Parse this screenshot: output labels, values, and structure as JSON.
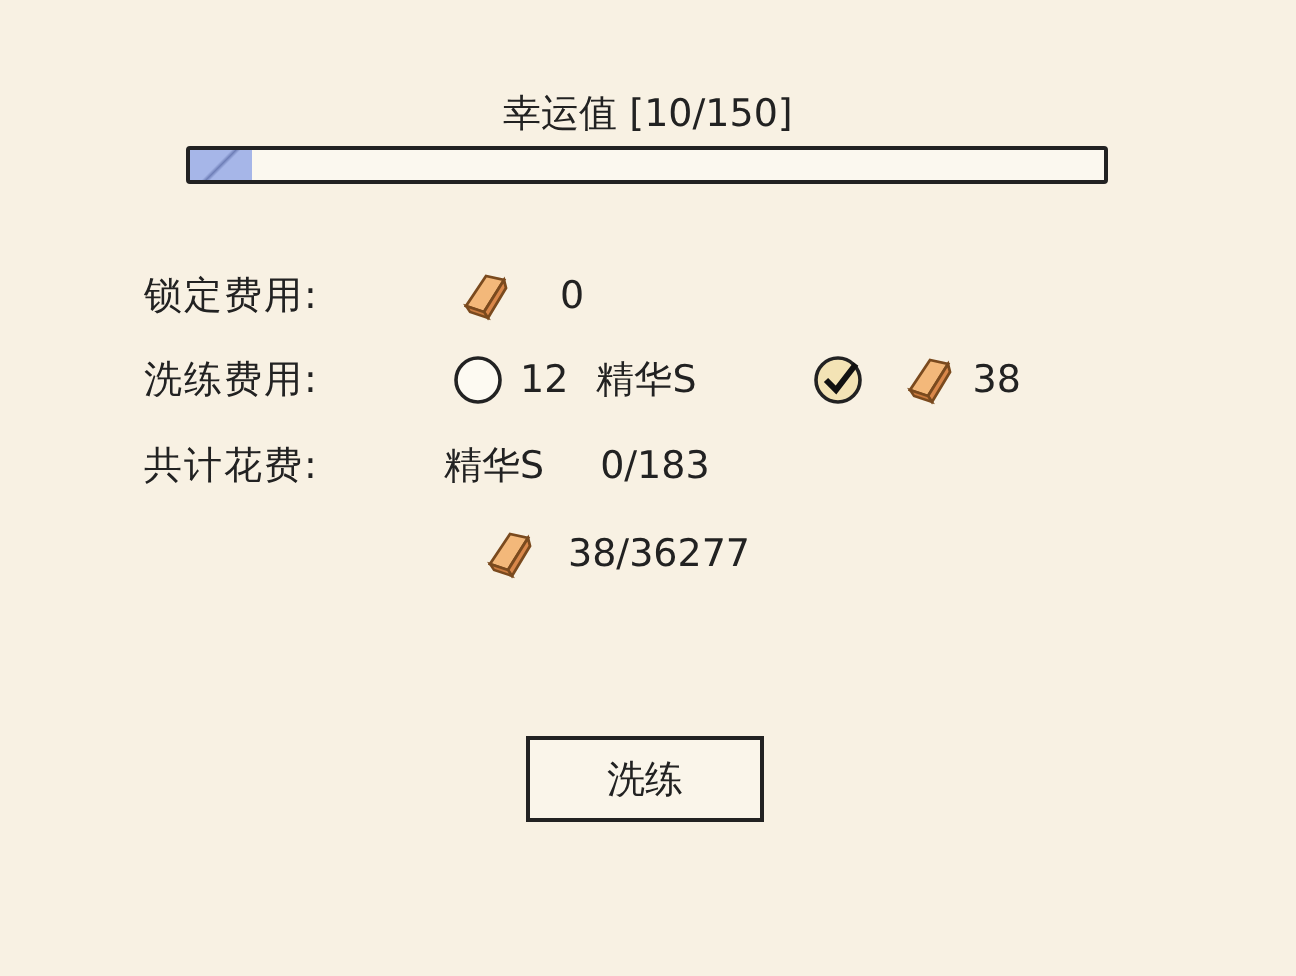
{
  "luck": {
    "title": "幸运值 [10/150]",
    "level": 0.067
  },
  "lock_cost": {
    "label": "锁定费用:",
    "amount": "0"
  },
  "refine_cost": {
    "label": "洗练费用:",
    "options": [
      {
        "kind": "material",
        "amount": "12",
        "material": "精华S",
        "selected": false
      },
      {
        "kind": "gold",
        "amount": "38",
        "selected": true
      }
    ]
  },
  "total_cost": {
    "label": "共计花费:",
    "material": "精华S",
    "material_amount": "0/183",
    "gold_amount": "38/36277"
  },
  "button": "洗练"
}
